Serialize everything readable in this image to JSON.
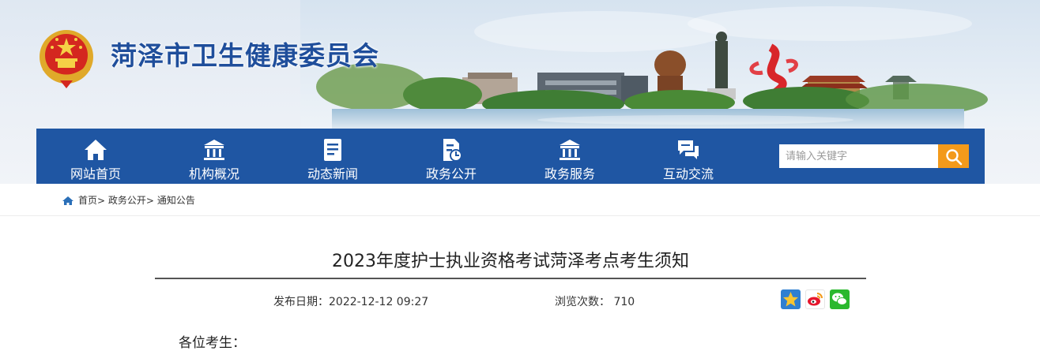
{
  "site": {
    "title": "菏泽市卫生健康委员会"
  },
  "nav": {
    "items": [
      {
        "label": "网站首页",
        "icon": "home-icon"
      },
      {
        "label": "机构概况",
        "icon": "institution-icon"
      },
      {
        "label": "动态新闻",
        "icon": "news-document-icon"
      },
      {
        "label": "政务公开",
        "icon": "public-document-icon"
      },
      {
        "label": "政务服务",
        "icon": "service-building-icon"
      },
      {
        "label": "互动交流",
        "icon": "chat-bubbles-icon"
      }
    ],
    "search": {
      "placeholder": "请输入关键字",
      "icon": "search-icon"
    },
    "colors": {
      "bar": "#1f56a3",
      "search_button": "#f39a1b"
    }
  },
  "breadcrumb": {
    "icon": "home-icon",
    "items": [
      "首页",
      "政务公开",
      "通知公告"
    ],
    "separator": ">"
  },
  "article": {
    "title": "2023年度护士执业资格考试菏泽考点考生须知",
    "publish_label": "发布日期：",
    "publish_date": "2022-12-12 09:27",
    "views_label": "浏览次数：",
    "views": "710",
    "share": [
      "star-share-icon",
      "weibo-share-icon",
      "wechat-share-icon"
    ],
    "body_first_line": "各位考生："
  }
}
